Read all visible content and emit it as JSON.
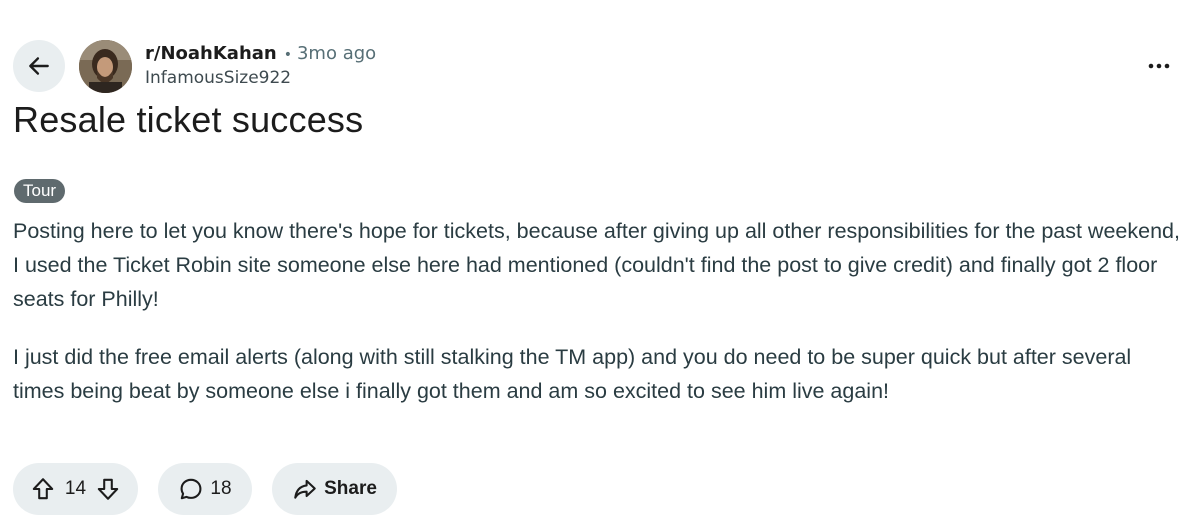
{
  "post": {
    "subreddit": "r/NoahKahan",
    "separator": "•",
    "time_ago": "3mo ago",
    "author": "InfamousSize922",
    "title": "Resale ticket success",
    "flair": "Tour",
    "body": [
      "Posting here to let you know there's hope for tickets, because after giving up all other responsibilities for the past weekend, I used the Ticket Robin site someone else here had mentioned (couldn't find the post to give credit) and finally got 2 floor seats for Philly!",
      "I just did the free email alerts (along with still stalking the TM app) and you do need to be super quick but after several times being beat by someone else i finally got them and am so excited to see him live again!"
    ]
  },
  "actions": {
    "vote_count": "14",
    "comment_count": "18",
    "share_label": "Share"
  },
  "icons": {
    "back": "arrow-left-icon",
    "more": "more-horizontal-icon",
    "upvote": "arrow-up-icon",
    "downvote": "arrow-down-icon",
    "comment": "speech-bubble-icon",
    "share": "share-arrow-icon"
  },
  "colors": {
    "button_bg": "#e9eef0",
    "flair_bg": "#5f6a6e",
    "body_text": "#2a3c42",
    "muted_text": "#576f76"
  }
}
